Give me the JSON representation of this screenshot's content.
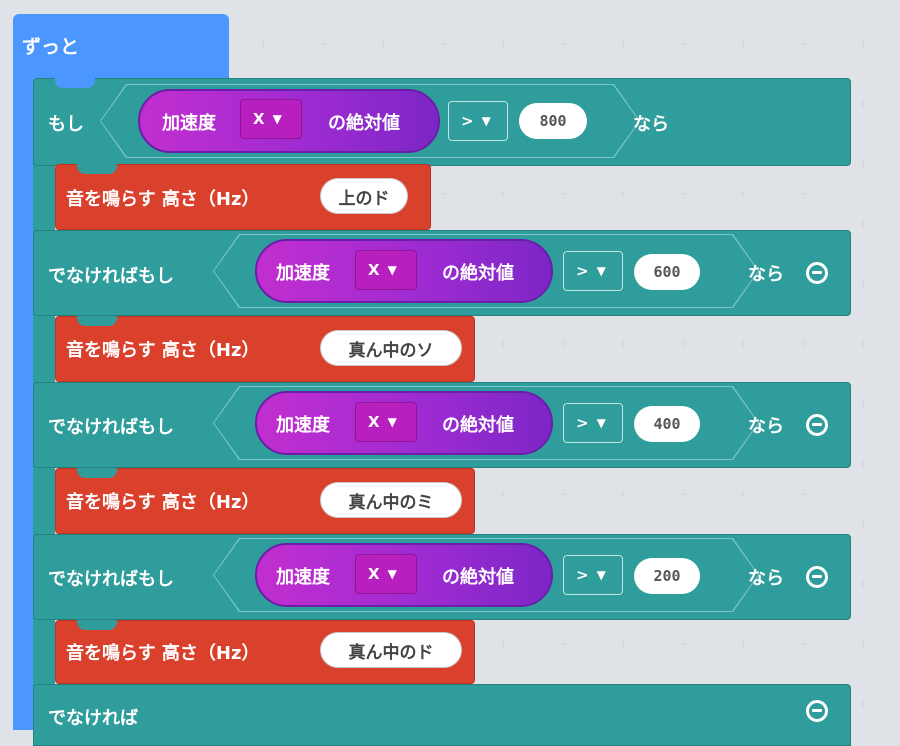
{
  "forever": {
    "label": "ずっと"
  },
  "colors": {
    "forever": "#4c97ff",
    "logic": "#2f9d9b",
    "music": "#d9412d",
    "input": "#b12ccd"
  },
  "if_block": {
    "if_label": "もし",
    "then_label": "なら",
    "else_if_label": "でなければもし",
    "else_label": "でなければ"
  },
  "conditions": [
    {
      "sensor": "加速度",
      "axis": "X",
      "abs_label": "の絶対値",
      "operator": ">",
      "value": "800"
    },
    {
      "sensor": "加速度",
      "axis": "X",
      "abs_label": "の絶対値",
      "operator": ">",
      "value": "600"
    },
    {
      "sensor": "加速度",
      "axis": "X",
      "abs_label": "の絶対値",
      "operator": ">",
      "value": "400"
    },
    {
      "sensor": "加速度",
      "axis": "X",
      "abs_label": "の絶対値",
      "operator": ">",
      "value": "200"
    }
  ],
  "tones": [
    {
      "label": "音を鳴らす 高さ（Hz）",
      "note": "上のド"
    },
    {
      "label": "音を鳴らす 高さ（Hz）",
      "note": "真ん中のソ"
    },
    {
      "label": "音を鳴らす 高さ（Hz）",
      "note": "真ん中のミ"
    },
    {
      "label": "音を鳴らす 高さ（Hz）",
      "note": "真ん中のド"
    }
  ],
  "icons": {
    "dropdown": "chevron-down-icon",
    "remove": "minus-circle-icon"
  }
}
